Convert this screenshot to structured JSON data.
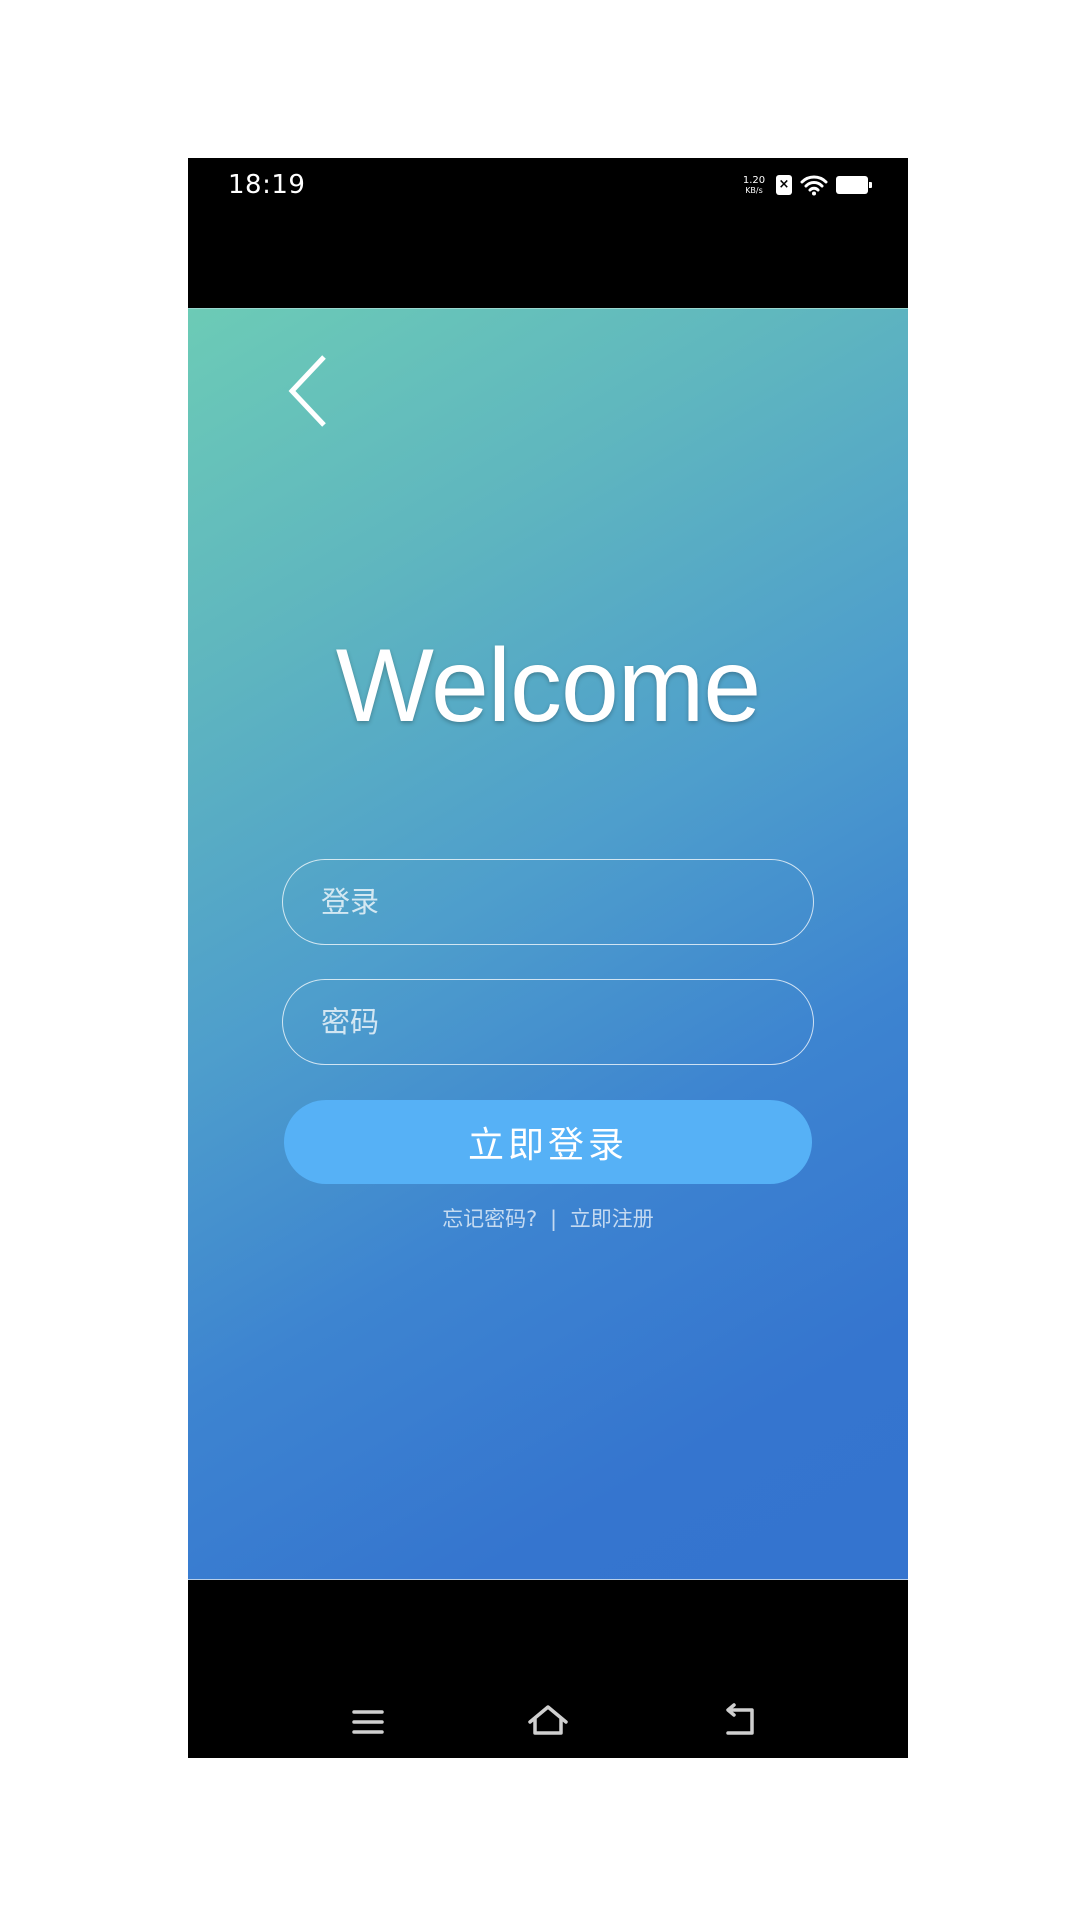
{
  "status_bar": {
    "time": "18:19",
    "net_speed_value": "1.20",
    "net_speed_unit": "KB/s",
    "sim_icon": "sim-off-icon",
    "wifi_icon": "wifi-icon",
    "battery_icon": "battery-icon"
  },
  "header": {
    "back_icon": "chevron-left-icon"
  },
  "main": {
    "title": "Welcome",
    "username_placeholder": "登录",
    "password_placeholder": "密码",
    "login_button_label": "立即登录",
    "forgot_password_link": "忘记密码?",
    "separator": "|",
    "register_link": "立即注册"
  },
  "nav_bar": {
    "menu_icon": "menu-icon",
    "home_icon": "home-icon",
    "back_icon": "back-icon"
  },
  "colors": {
    "gradient_start": "#6ccbb6",
    "gradient_end": "#3474cf",
    "button": "#56b1f6"
  }
}
